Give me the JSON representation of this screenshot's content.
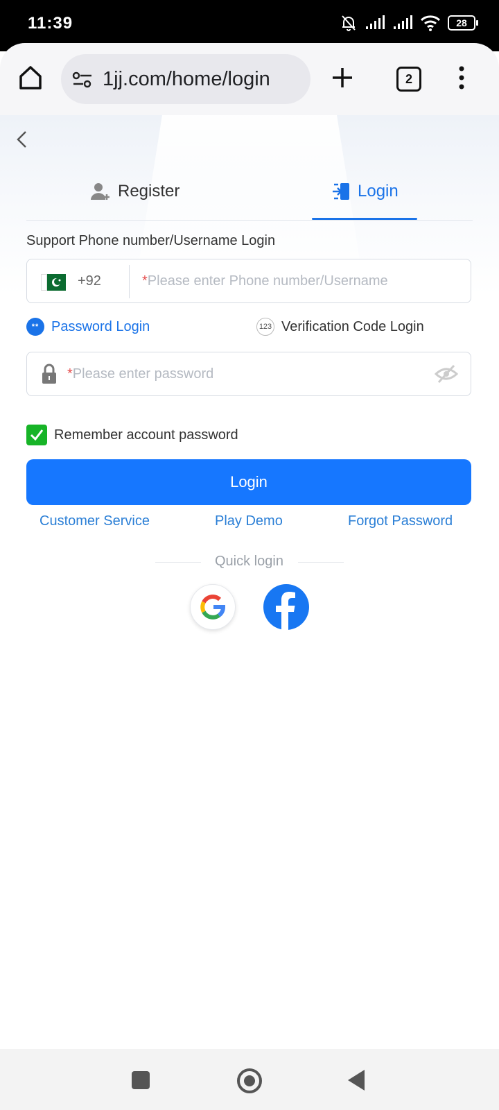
{
  "status_bar": {
    "time": "11:39",
    "battery": "28"
  },
  "browser": {
    "url": "1jj.com/home/login",
    "tab_count": "2"
  },
  "auth_tabs": [
    {
      "label": "Register",
      "active": false
    },
    {
      "label": "Login",
      "active": true
    }
  ],
  "form": {
    "support_label": "Support Phone number/Username Login",
    "country_code": "+92",
    "phone_placeholder": "Please enter Phone number/Username",
    "required_mark": "*",
    "password_placeholder": "Please enter password",
    "remember_label": "Remember account password",
    "remember_checked": true,
    "login_button": "Login"
  },
  "login_modes": [
    {
      "label": "Password Login",
      "selected": true
    },
    {
      "label": "Verification Code Login",
      "selected": false
    }
  ],
  "login_mode_icons": {
    "password": "**",
    "code": "123"
  },
  "links": {
    "customer_service": "Customer Service",
    "play_demo": "Play Demo",
    "forgot_password": "Forgot Password"
  },
  "quick_login": {
    "label": "Quick login",
    "providers": [
      "google-icon",
      "facebook-icon"
    ]
  },
  "colors": {
    "accent": "#1677ff",
    "link": "#2b7fd6",
    "checkbox": "#17b427",
    "facebook": "#1877f2"
  }
}
